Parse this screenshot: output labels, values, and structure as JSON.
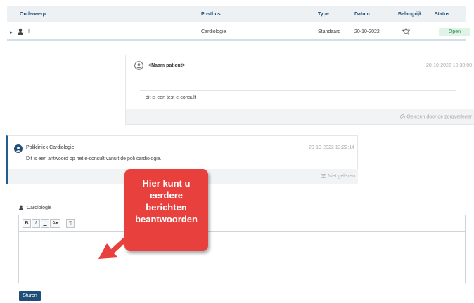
{
  "table": {
    "headers": {
      "subject": "Onderwerp",
      "mailbox": "Postbus",
      "type": "Type",
      "date": "Datum",
      "important": "Belangrijk",
      "status": "Status"
    },
    "row": {
      "expand": "▸",
      "subject": "!",
      "mailbox": "Cardiologie",
      "type": "Standaard",
      "date": "20-10-2022",
      "important_icon": "star-outline-icon",
      "status": "Open"
    }
  },
  "messages": [
    {
      "sender": "<Naam patient>",
      "timestamp": "20-10-2022 10:30:00",
      "body": "dit is een test e-consult",
      "footer": "Gelezen door de zorgverlener"
    },
    {
      "sender": "Polikliniek Cardiologie",
      "timestamp": "20-10-2022 13:22:14",
      "body": "Dit is een antwoord op het e-consult vanuit de poli cardiologie.",
      "footer": "Niet gelezen"
    }
  ],
  "reply": {
    "recipient": "Cardiologie",
    "toolbar": [
      "B",
      "I",
      "U",
      "A▾",
      "¶"
    ],
    "send_label": "Sturen"
  },
  "callout": {
    "lines": [
      "Hier kunt u",
      "eerdere",
      "berichten",
      "beantwoorden"
    ],
    "color": "#e8403d"
  },
  "colors": {
    "accent": "#1f4e79",
    "status_open_bg": "#dff3e6",
    "status_open_text": "#2d8a4e"
  }
}
